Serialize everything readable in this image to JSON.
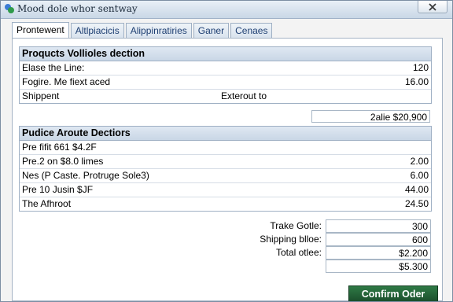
{
  "window": {
    "title": "Mood dole whor sentway"
  },
  "tabs": [
    {
      "label": "Prontewent",
      "active": true
    },
    {
      "label": "Altlpiacicis",
      "active": false
    },
    {
      "label": "Alippinratiries",
      "active": false
    },
    {
      "label": "Ganer",
      "active": false
    },
    {
      "label": "Cenaes",
      "active": false
    }
  ],
  "products_section": {
    "title": "Proqucts Vollioles dection",
    "rows": [
      {
        "label": "Elase the Line:",
        "mid": "",
        "value": "120"
      },
      {
        "label": "Fogire. Me fiext aced",
        "mid": "",
        "value": "16.00"
      },
      {
        "label": "Shippent",
        "mid": "Exterout to",
        "value": ""
      }
    ],
    "subtotal": "2alie $20,900"
  },
  "price_section": {
    "title": "Pudice Aroute Dectiors",
    "rows": [
      {
        "label": "Pre fifit 661 $4.2F",
        "value": ""
      },
      {
        "label": "Pre.2 on $8.0 limes",
        "value": "2.00"
      },
      {
        "label": "Nes (P Caste. Protruge Sole3)",
        "value": "6.00"
      },
      {
        "label": "Pre 10 Jusin $JF",
        "value": "44.00"
      },
      {
        "label": "The Afhroot",
        "value": "24.50"
      }
    ]
  },
  "summary": {
    "rows": [
      {
        "label": "Trake Gotle:",
        "value": "300"
      },
      {
        "label": "Shipping blloe:",
        "value": "600"
      },
      {
        "label": "Total otlee:",
        "value": "$2.200"
      },
      {
        "label": "",
        "value": "$5.300"
      }
    ]
  },
  "confirm_button": {
    "label": "Confirm Oder"
  },
  "colors": {
    "accent": "#1f5c33",
    "tab_text": "#1e3f72",
    "header_bg": "#d4e0ec"
  }
}
